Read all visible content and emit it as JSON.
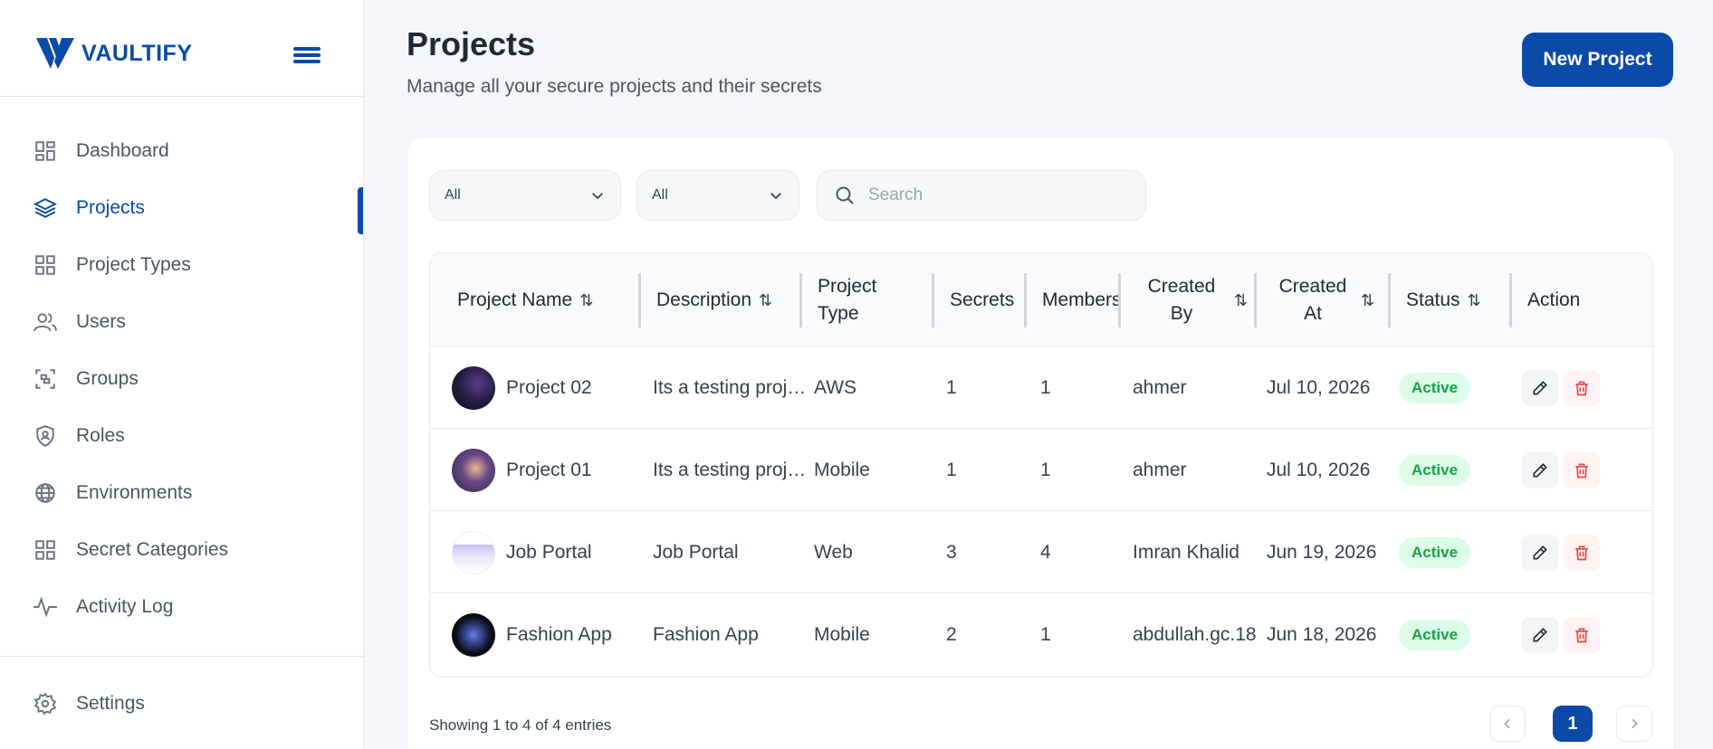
{
  "brand": {
    "name": "VAULTIFY"
  },
  "sidebar": {
    "items": [
      {
        "label": "Dashboard",
        "icon": "dashboard-icon"
      },
      {
        "label": "Projects",
        "icon": "layers-icon",
        "active": true
      },
      {
        "label": "Project Types",
        "icon": "grid-icon"
      },
      {
        "label": "Users",
        "icon": "users-icon"
      },
      {
        "label": "Groups",
        "icon": "groups-icon"
      },
      {
        "label": "Roles",
        "icon": "shield-user-icon"
      },
      {
        "label": "Environments",
        "icon": "globe-icon"
      },
      {
        "label": "Secret Categories",
        "icon": "categories-icon"
      },
      {
        "label": "Activity Log",
        "icon": "activity-icon"
      }
    ],
    "settings": {
      "label": "Settings",
      "icon": "gear-icon"
    }
  },
  "header": {
    "title": "Projects",
    "subtitle": "Manage all your secure projects and their secrets",
    "new_button": "New Project"
  },
  "filters": {
    "filter1": "All",
    "filter2": "All",
    "search_placeholder": "Search"
  },
  "table": {
    "columns": [
      "Project Name",
      "Description",
      "Project Type",
      "Secrets",
      "Members",
      "Created By",
      "Created At",
      "Status",
      "Action"
    ],
    "rows": [
      {
        "name": "Project 02",
        "description": "Its a testing proj…",
        "type": "AWS",
        "secrets": "1",
        "members": "1",
        "created_by": "ahmer",
        "created_at": "Jul 10, 2026",
        "status": "Active"
      },
      {
        "name": "Project 01",
        "description": "Its a testing proj…",
        "type": "Mobile",
        "secrets": "1",
        "members": "1",
        "created_by": "ahmer",
        "created_at": "Jul 10, 2026",
        "status": "Active"
      },
      {
        "name": "Job Portal",
        "description": "Job Portal",
        "type": "Web",
        "secrets": "3",
        "members": "4",
        "created_by": "Imran Khalid",
        "created_at": "Jun 19, 2026",
        "status": "Active"
      },
      {
        "name": "Fashion App",
        "description": "Fashion App",
        "type": "Mobile",
        "secrets": "2",
        "members": "1",
        "created_by": "abdullah.gc.18",
        "created_at": "Jun 18, 2026",
        "status": "Active"
      }
    ]
  },
  "footer": {
    "showing": "Showing 1 to 4 of 4 entries",
    "current_page": "1"
  },
  "colors": {
    "accent": "#0b4aa8",
    "active_badge_bg": "#dcfce7",
    "active_badge_text": "#16a34a"
  }
}
